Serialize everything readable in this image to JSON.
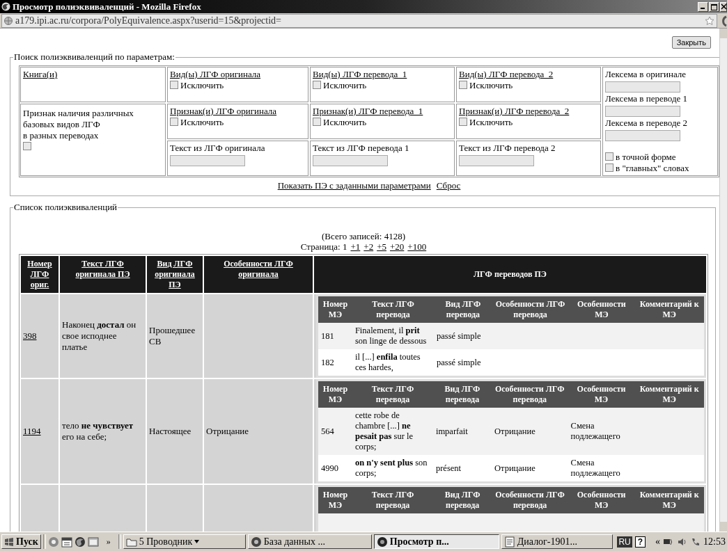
{
  "window": {
    "title": "Просмотр полиэквиваленций - Mozilla Firefox"
  },
  "address_bar": {
    "url": "a179.ipi.ac.ru/corpora/PolyEquivalence.aspx?userid=15&projectid="
  },
  "close_button": "Закрыть",
  "search_panel": {
    "legend": "Поиск полиэквиваленций по параметрам:",
    "book_link": "Книга(и)",
    "variety_filter": {
      "lines": [
        "Признак наличия различных",
        "базовых видов ЛГФ",
        "в разных переводах"
      ],
      "checked": false
    },
    "columns": [
      {
        "type_link": "Вид(ы) ЛГФ оригинала",
        "type_exclude": {
          "label": "Исключить",
          "checked": false
        },
        "feature_link": "Признак(и) ЛГФ оригинала",
        "feature_exclude": {
          "label": "Исключить",
          "checked": false
        },
        "text_label": "Текст из ЛГФ оригинала"
      },
      {
        "type_link": "Вид(ы) ЛГФ перевода_1",
        "type_exclude": {
          "label": "Исключить",
          "checked": false
        },
        "feature_link": "Признак(и) ЛГФ перевода_1",
        "feature_exclude": {
          "label": "Исключить",
          "checked": false
        },
        "text_label": "Текст из ЛГФ перевода 1"
      },
      {
        "type_link": "Вид(ы) ЛГФ перевода_2",
        "type_exclude": {
          "label": "Исключить",
          "checked": false
        },
        "feature_link": "Признак(и) ЛГФ перевода_2",
        "feature_exclude": {
          "label": "Исключить",
          "checked": false
        },
        "text_label": "Текст из ЛГФ перевода 2"
      }
    ],
    "lexeme_fields": [
      {
        "label": "Лексема в оригинале"
      },
      {
        "label": "Лексема в переводе 1"
      },
      {
        "label": "Лексема в переводе 2"
      }
    ],
    "options": [
      {
        "label": "в точной форме",
        "checked": false
      },
      {
        "label": "в \"главных\" словах",
        "checked": false
      }
    ],
    "show_link": "Показать ПЭ с заданными параметрами",
    "reset_link": "Сброс"
  },
  "list_panel": {
    "legend": "Список полиэквиваленций",
    "total": "(Всего записей: 4128)",
    "page_label": "Страница: 1",
    "page_links": [
      "+1",
      "+2",
      "+5",
      "+20",
      "+100"
    ],
    "table": {
      "columns": [
        {
          "label": "Номер ЛГФ ориг.",
          "kind": "link"
        },
        {
          "label": "Текст ЛГФ оригинала ПЭ",
          "kind": "link"
        },
        {
          "label": "Вид ЛГФ оригинала ПЭ",
          "kind": "link"
        },
        {
          "label": "Особенности ЛГФ оригинала",
          "kind": "link"
        },
        {
          "label": "ЛГФ переводов ПЭ",
          "kind": "text"
        }
      ],
      "rows": [
        {
          "number": "398",
          "text": "Наконец **достал** он свое исподнее платье",
          "type": "Прошедшее СВ",
          "translation_columns": [
            "Номер МЭ",
            "Текст ЛГФ перевода",
            "Вид ЛГФ перевода",
            "Особенности ЛГФ перевода",
            "Особенности МЭ",
            "Комментарий к МЭ"
          ],
          "translations": [
            {
              "number": "181",
              "text": "Finalement, il **prit** son linge de dessous",
              "type": "passé simple"
            },
            {
              "number": "182",
              "text": "il [...] **enfila** toutes ces hardes,",
              "type": "passé simple"
            }
          ]
        },
        {
          "number": "1194",
          "text": "тело **не чувствует** его на себе;",
          "type": "Настоящее",
          "features": "Отрицание",
          "translation_columns": [
            "Номер МЭ",
            "Текст ЛГФ перевода",
            "Вид ЛГФ перевода",
            "Особенности ЛГФ перевода",
            "Особенности МЭ",
            "Комментарий к МЭ"
          ],
          "translations": [
            {
              "number": "564",
              "text": "cette robe de chambre [...] **ne pesait pas** sur le corps;",
              "type": "imparfait",
              "features": "Отрицание",
              "me_features": "Смена подлежащего"
            },
            {
              "number": "4990",
              "text": "**on n'y sent plus** son corps;",
              "type": "présent",
              "features": "Отрицание",
              "me_features": "Смена подлежащего"
            }
          ]
        },
        {
          "translation_columns": [
            "Номер МЭ",
            "Текст ЛГФ перевода",
            "Вид ЛГФ перевода",
            "Особенности ЛГФ перевода",
            "Особенности МЭ",
            "Комментарий к МЭ"
          ]
        }
      ]
    }
  },
  "taskbar": {
    "start": "Пуск",
    "more": "»",
    "tasks": [
      {
        "label": "5 Проводник",
        "selected": false
      },
      {
        "label": "База данных ...",
        "selected": false
      },
      {
        "label": "Просмотр п...",
        "selected": true
      },
      {
        "label": "Диалог-1901...",
        "selected": false
      }
    ],
    "language": "RU",
    "help": "?",
    "tray_more": "«",
    "clock": "12:53"
  }
}
